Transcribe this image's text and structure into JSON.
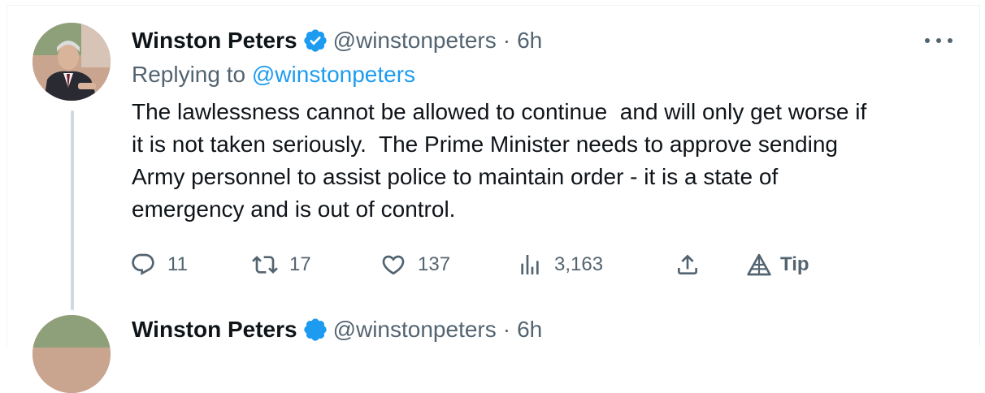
{
  "tweet": {
    "author_name": "Winston Peters",
    "author_handle": "@winstonpeters",
    "separator": "·",
    "timestamp": "6h",
    "reply_prefix": "Replying to ",
    "reply_to": "@winstonpeters",
    "text": "The lawlessness cannot be allowed to continue  and will only get worse if\nit is not taken seriously.  The Prime Minister needs to approve sending\nArmy personnel to assist police to maintain order - it is a state of\nemergency and is out of control.",
    "verified": true,
    "actions": {
      "replies": "11",
      "retweets": "17",
      "likes": "137",
      "views": "3,163",
      "tip_label": "Tip"
    }
  },
  "next_tweet": {
    "author_name": "Winston Peters",
    "author_handle": "@winstonpeters",
    "separator": "·",
    "timestamp": "6h"
  },
  "colors": {
    "text_primary": "#0f1419",
    "text_secondary": "#536471",
    "link": "#1d9bf0",
    "thread_line": "#cfd9de"
  }
}
